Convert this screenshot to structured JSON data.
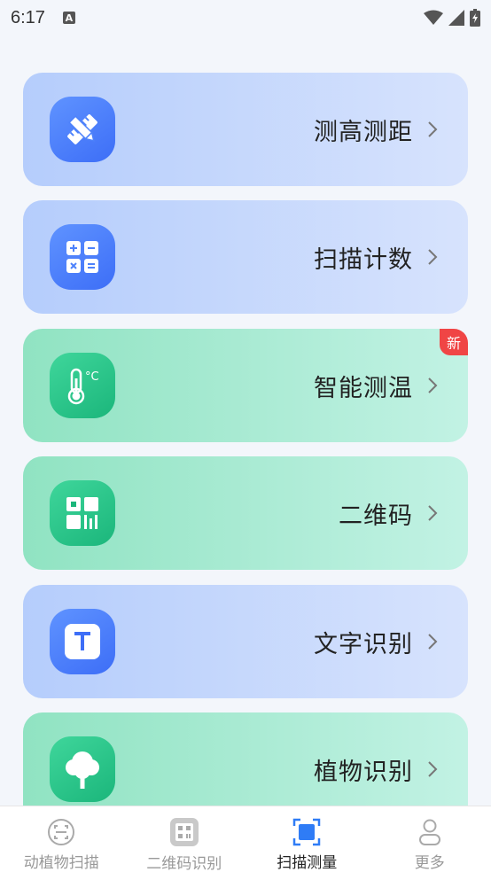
{
  "status_bar": {
    "time": "6:17",
    "notification_letter": "A"
  },
  "cards": [
    {
      "label": "测高测距",
      "icon": "ruler-pencil-icon",
      "theme": "blue"
    },
    {
      "label": "扫描计数",
      "icon": "calculator-icon",
      "theme": "blue"
    },
    {
      "label": "智能测温",
      "icon": "thermometer-icon",
      "theme": "green",
      "badge": "新"
    },
    {
      "label": "二维码",
      "icon": "qr-code-icon",
      "theme": "green"
    },
    {
      "label": "文字识别",
      "icon": "text-t-icon",
      "theme": "blue"
    },
    {
      "label": "植物识别",
      "icon": "tree-icon",
      "theme": "green"
    }
  ],
  "bottom_nav": [
    {
      "label": "动植物扫描",
      "icon": "scan-face-icon",
      "active": false
    },
    {
      "label": "二维码识别",
      "icon": "qr-scan-icon",
      "active": false
    },
    {
      "label": "扫描测量",
      "icon": "scan-square-icon",
      "active": true
    },
    {
      "label": "更多",
      "icon": "user-icon",
      "active": false
    }
  ],
  "colors": {
    "accent_blue": "#3d6ef7",
    "accent_green": "#1bb67b",
    "badge_red": "#f04545",
    "active_nav": "#2f7cf6"
  }
}
